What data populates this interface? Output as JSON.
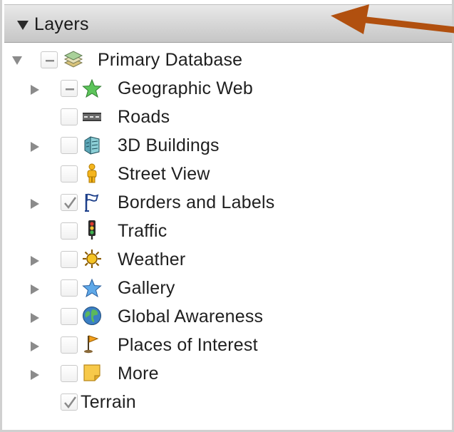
{
  "panel": {
    "title": "Layers"
  },
  "tree": {
    "root": {
      "label": "Primary Database",
      "expanded": true,
      "check_state": "partial"
    },
    "items": [
      {
        "label": "Geographic Web",
        "expandable": true,
        "check_state": "partial",
        "icon": "green-star-icon"
      },
      {
        "label": "Roads",
        "expandable": false,
        "check_state": "unchecked",
        "icon": "road-icon"
      },
      {
        "label": "3D Buildings",
        "expandable": true,
        "check_state": "unchecked",
        "icon": "building-icon"
      },
      {
        "label": "Street View",
        "expandable": false,
        "check_state": "unchecked",
        "icon": "pegman-icon"
      },
      {
        "label": "Borders and Labels",
        "expandable": true,
        "check_state": "checked",
        "icon": "flag-icon"
      },
      {
        "label": "Traffic",
        "expandable": false,
        "check_state": "unchecked",
        "icon": "traffic-light-icon"
      },
      {
        "label": "Weather",
        "expandable": true,
        "check_state": "unchecked",
        "icon": "sun-icon"
      },
      {
        "label": "Gallery",
        "expandable": true,
        "check_state": "unchecked",
        "icon": "blue-star-icon"
      },
      {
        "label": "Global Awareness",
        "expandable": true,
        "check_state": "unchecked",
        "icon": "globe-icon"
      },
      {
        "label": "Places of Interest",
        "expandable": true,
        "check_state": "unchecked",
        "icon": "pin-flag-icon"
      },
      {
        "label": "More",
        "expandable": true,
        "check_state": "unchecked",
        "icon": "sticky-note-icon"
      },
      {
        "label": "Terrain",
        "expandable": false,
        "check_state": "checked",
        "icon": "none"
      }
    ]
  },
  "colors": {
    "annotation_arrow": "#b1500f",
    "header_top": "#e8e8e8",
    "header_bottom": "#c6c6c6"
  }
}
